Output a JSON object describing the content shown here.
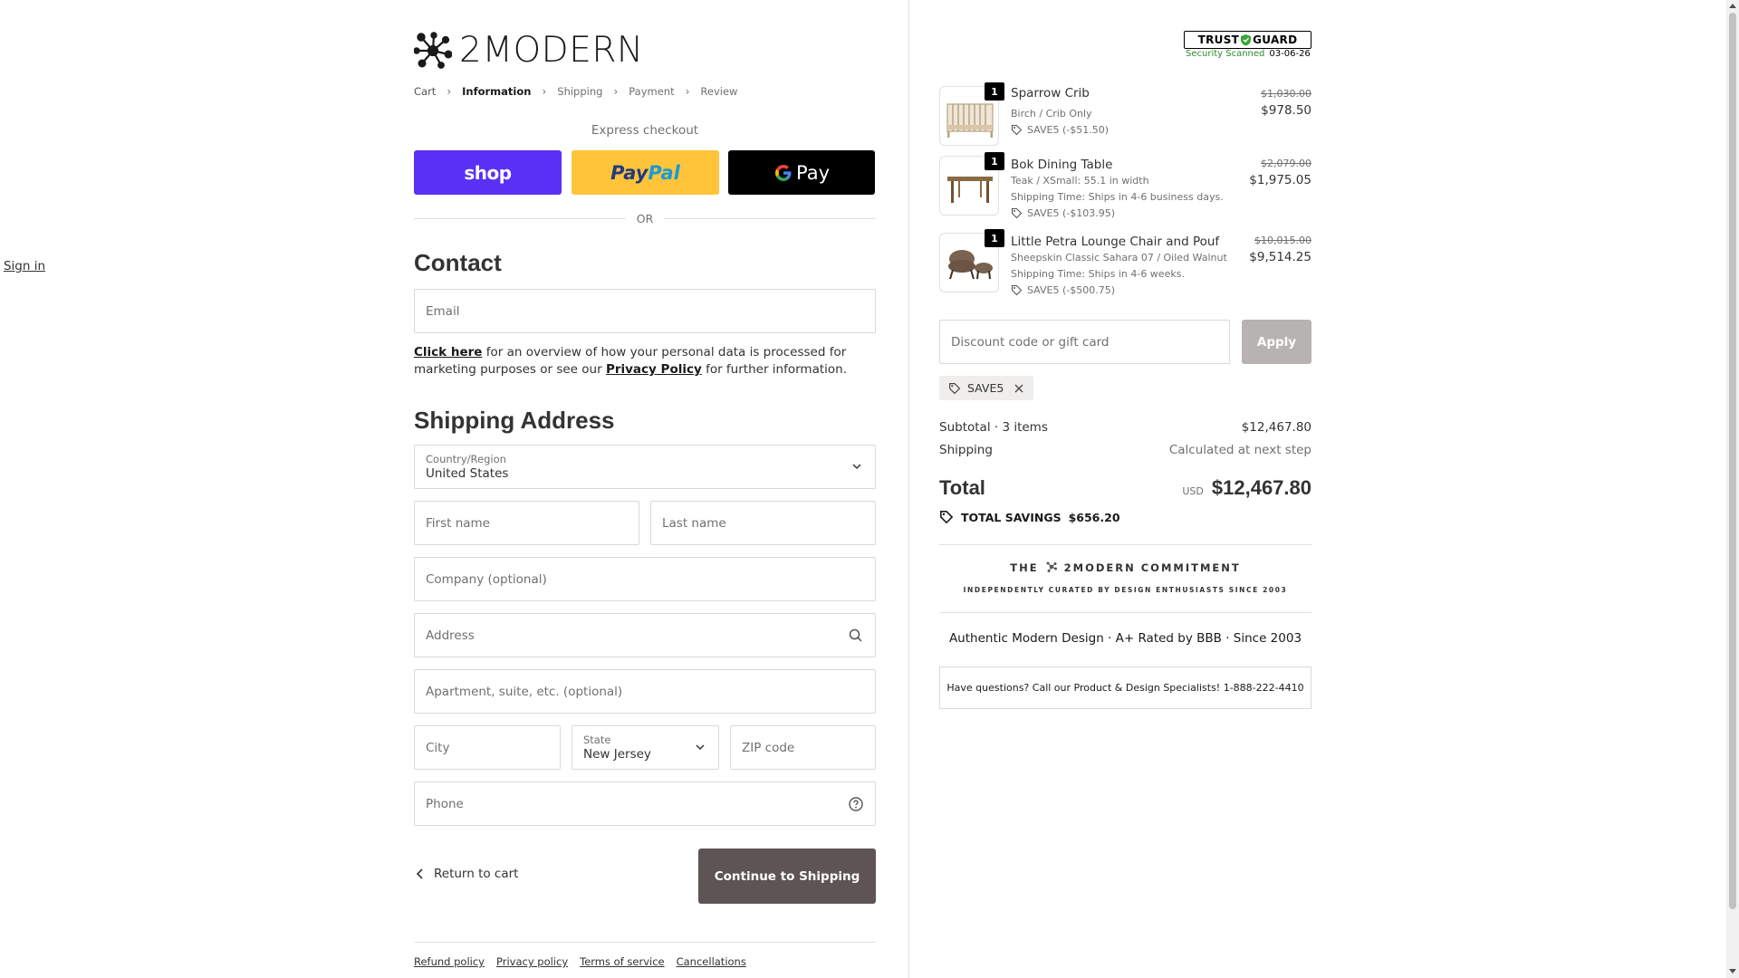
{
  "brand": {
    "name": "2MODERN"
  },
  "breadcrumb": [
    "Cart",
    "Information",
    "Shipping",
    "Payment",
    "Review"
  ],
  "express": {
    "label": "Express checkout",
    "shop": "shop",
    "paypal_a": "Pay",
    "paypal_b": "Pal",
    "gpay": "Pay",
    "or": "OR"
  },
  "contact": {
    "title": "Contact",
    "sign_in": "Sign in",
    "email_placeholder": "Email"
  },
  "note": {
    "link1": "Click here",
    "text1": " for an overview of how your personal data is processed for marketing purposes or see our ",
    "link2": "Privacy Policy",
    "text2": " for further information."
  },
  "shipping": {
    "title": "Shipping Address",
    "country_label": "Country/Region",
    "country_value": "United States",
    "first_name": "First name",
    "last_name": "Last name",
    "company": "Company (optional)",
    "address": "Address",
    "apartment": "Apartment, suite, etc. (optional)",
    "city": "City",
    "state_label": "State",
    "state_value": "New Jersey",
    "zip": "ZIP code",
    "phone": "Phone"
  },
  "actions": {
    "return": "Return to cart",
    "continue": "Continue to Shipping"
  },
  "footer": [
    "Refund policy",
    "Privacy policy",
    "Terms of service",
    "Cancellations"
  ],
  "trust": {
    "brand_a": "TRUST",
    "brand_b": "GUARD",
    "scanned": "Security Scanned",
    "date": "03-06-26"
  },
  "cart": [
    {
      "qty": "1",
      "name": "Sparrow Crib",
      "variant": "Birch / Crib Only",
      "shipping": "",
      "discount": "SAVE5 (-$51.50)",
      "original": "$1,030.00",
      "price": "$978.50"
    },
    {
      "qty": "1",
      "name": "Bok Dining Table",
      "variant": "Teak / XSmall: 55.1 in width",
      "shipping": "Shipping Time: Ships in 4-6 business days.",
      "discount": "SAVE5 (-$103.95)",
      "original": "$2,079.00",
      "price": "$1,975.05"
    },
    {
      "qty": "1",
      "name": "Little Petra Lounge Chair and Pouf",
      "variant": "Sheepskin Classic Sahara 07 / Oiled Walnut",
      "shipping": "Shipping Time: Ships in 4-6 weeks.",
      "discount": "SAVE5 (-$500.75)",
      "original": "$10,015.00",
      "price": "$9,514.25"
    }
  ],
  "discount": {
    "placeholder": "Discount code or gift card",
    "apply": "Apply",
    "code": "SAVE5"
  },
  "summary": {
    "subtotal_label": "Subtotal · 3 items",
    "subtotal_value": "$12,467.80",
    "shipping_label": "Shipping",
    "shipping_value": "Calculated at next step",
    "total_label": "Total",
    "currency": "USD",
    "total_value": "$12,467.80",
    "savings_label": "TOTAL SAVINGS",
    "savings_value": "$656.20"
  },
  "commitment": {
    "title_a": "THE",
    "title_b": "2MODERN COMMITMENT",
    "subtitle": "INDEPENDENTLY CURATED BY DESIGN ENTHUSIASTS SINCE 2003",
    "tagline": "Authentic Modern Design · A+ Rated by BBB · Since 2003",
    "questions": "Have questions? Call our Product & Design Specialists! 1-888-222-4410"
  },
  "colors": {
    "shop": "#5a31f4",
    "paypal": "#ffc439",
    "gpay": "#000000",
    "continue": "#5f5454",
    "apply": "#b8b3b3"
  }
}
